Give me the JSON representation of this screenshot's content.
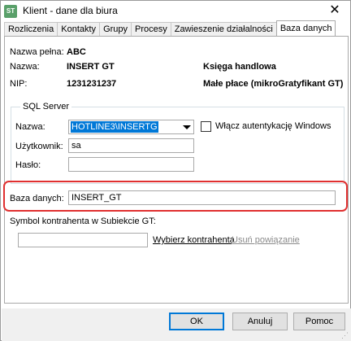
{
  "window": {
    "title": "Klient - dane dla biura",
    "icon_text": "ST",
    "close_glyph": "✕"
  },
  "tabs": [
    {
      "label": "Rozliczenia",
      "active": false
    },
    {
      "label": "Kontakty",
      "active": false
    },
    {
      "label": "Grupy",
      "active": false
    },
    {
      "label": "Procesy",
      "active": false
    },
    {
      "label": "Zawieszenie działalności",
      "active": false
    },
    {
      "label": "Baza danych",
      "active": true
    }
  ],
  "info": {
    "full_name_label": "Nazwa pełna:",
    "full_name_value": "ABC",
    "name_label": "Nazwa:",
    "name_value": "INSERT GT",
    "nip_label": "NIP:",
    "nip_value": "1231231237",
    "accounting": "Księga handlowa",
    "payroll": "Małe płace (mikroGratyfikant GT)"
  },
  "sql_server": {
    "group_title": "SQL Server",
    "name_label": "Nazwa:",
    "name_value": "HOTLINE3\\INSERTG",
    "windows_auth_label": "Włącz autentykację Windows",
    "windows_auth_checked": false,
    "user_label": "Użytkownik:",
    "user_value": "sa",
    "password_label": "Hasło:",
    "password_value": ""
  },
  "database": {
    "label": "Baza danych:",
    "value": "INSERT_GT",
    "highlight_color": "#e03030"
  },
  "contractor": {
    "label": "Symbol kontrahenta w Subiekcie GT:",
    "value": "",
    "choose_link": "Wybierz kontrahenta",
    "remove_link": "Usuń powiązanie"
  },
  "footer": {
    "ok_label": "OK",
    "cancel_label": "Anuluj",
    "help_label": "Pomoc"
  },
  "colors": {
    "selection": "#0078d7",
    "highlight": "#e03030"
  }
}
